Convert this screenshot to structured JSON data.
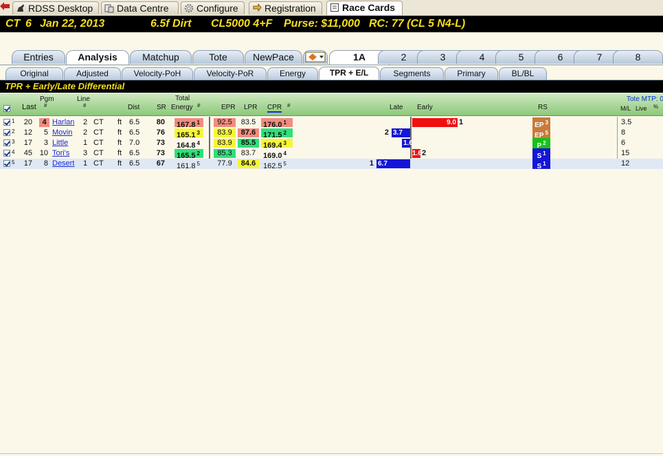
{
  "app_tabs": [
    {
      "label": "RDSS Desktop",
      "icon": "horse-icon"
    },
    {
      "label": "Data Centre",
      "icon": "database-icon"
    },
    {
      "label": "Configure",
      "icon": "gear-icon"
    },
    {
      "label": "Registration",
      "icon": "registration-icon"
    },
    {
      "label": "Race Cards",
      "icon": "race-card-icon"
    }
  ],
  "race": {
    "track": "CT",
    "race_no": "6",
    "date": "Jan 22, 2013",
    "distance_surface": "6.5f  Dirt",
    "class": "CL5000  4+F",
    "purse": "Purse: $11,000",
    "rc": "RC: 77  (CL 5 N4-L)"
  },
  "view_tabs": [
    "Entries",
    "Analysis",
    "Matchup",
    "Tote",
    "NewPace",
    "",
    "1A",
    "2",
    "3",
    "4",
    "5",
    "6",
    "7",
    "8"
  ],
  "sub_tabs": [
    "Original",
    "Adjusted",
    "Velocity-PoH",
    "Velocity-PoR",
    "Energy",
    "TPR + E/L",
    "Segments",
    "Primary",
    "BL/BL"
  ],
  "section_title": "TPR + Early/Late Differential",
  "grid_headers": {
    "last": "Last",
    "pgm": "Pgm",
    "pgm_hash": "#",
    "line": "Line",
    "line_hash": "#",
    "dist": "Dist",
    "sr": "SR",
    "total": "Total",
    "energy": "Energy",
    "energy_hash": "#",
    "epr": "EPR",
    "lpr": "LPR",
    "cpr": "CPR",
    "cpr_hash": "#",
    "late": "Late",
    "early": "Early",
    "rs": "RS",
    "tote_mtp": "Tote MTP: 0",
    "ml": "M/L",
    "live": "Live",
    "pct": "%"
  },
  "rows": [
    {
      "num": "1",
      "last": "20",
      "pgm": "4",
      "name": "Harlan",
      "line": "2",
      "trk": "CT",
      "unit": "ft",
      "dist": "6.5",
      "sr": "80",
      "energy": "167.8",
      "energy_rank": "1",
      "epr": "92.5",
      "lpr": "83.5",
      "cpr": "176.0",
      "cpr_rank": "1",
      "late_val": "",
      "late_rank": "",
      "early_val": "9.0",
      "early_rank": "1",
      "rs": "EP",
      "rs_rank": "3",
      "ml": "3.5"
    },
    {
      "num": "2",
      "last": "12",
      "pgm": "5",
      "name": "Movin",
      "line": "2",
      "trk": "CT",
      "unit": "ft",
      "dist": "6.5",
      "sr": "76",
      "energy": "165.1",
      "energy_rank": "3",
      "epr": "83.9",
      "lpr": "87.6",
      "cpr": "171.5",
      "cpr_rank": "2",
      "late_val": "3.7",
      "late_rank": "2",
      "early_val": "",
      "early_rank": "",
      "rs": "EP",
      "rs_rank": "5",
      "ml": "8"
    },
    {
      "num": "3",
      "last": "17",
      "pgm": "3",
      "name": "Little",
      "line": "1",
      "trk": "CT",
      "unit": "ft",
      "dist": "7.0",
      "sr": "73",
      "energy": "164.8",
      "energy_rank": "4",
      "epr": "83.9",
      "lpr": "85.5",
      "cpr": "169.4",
      "cpr_rank": "3",
      "late_val": "1.6",
      "late_rank": "",
      "early_val": "",
      "early_rank": "",
      "rs": "P",
      "rs_rank": "2",
      "ml": "6"
    },
    {
      "num": "4",
      "last": "45",
      "pgm": "10",
      "name": "Tori's",
      "line": "3",
      "trk": "CT",
      "unit": "ft",
      "dist": "6.5",
      "sr": "73",
      "energy": "165.5",
      "energy_rank": "2",
      "epr": "85.3",
      "lpr": "83.7",
      "cpr": "169.0",
      "cpr_rank": "4",
      "late_val": "",
      "late_rank": "",
      "early_val": "1.6",
      "early_rank": "2",
      "rs": "S",
      "rs_rank": "1",
      "ml": "15"
    },
    {
      "num": "5",
      "last": "17",
      "pgm": "8",
      "name": "Desert",
      "line": "1",
      "trk": "CT",
      "unit": "ft",
      "dist": "6.5",
      "sr": "67",
      "energy": "161.8",
      "energy_rank": "5",
      "epr": "77.9",
      "lpr": "84.6",
      "cpr": "162.5",
      "cpr_rank": "5",
      "late_val": "6.7",
      "late_rank": "1",
      "early_val": "",
      "early_rank": "",
      "rs": "S",
      "rs_rank": "1",
      "ml": "12"
    }
  ],
  "colors": {
    "red": "#f08c7f",
    "yellow": "#f7f536",
    "green": "#2fe07a",
    "bar_red": "#f01010",
    "bar_blue": "#1515d8",
    "rs_ep": "#c87a3a",
    "rs_p": "#18c218",
    "rs_s": "#1515d8"
  }
}
